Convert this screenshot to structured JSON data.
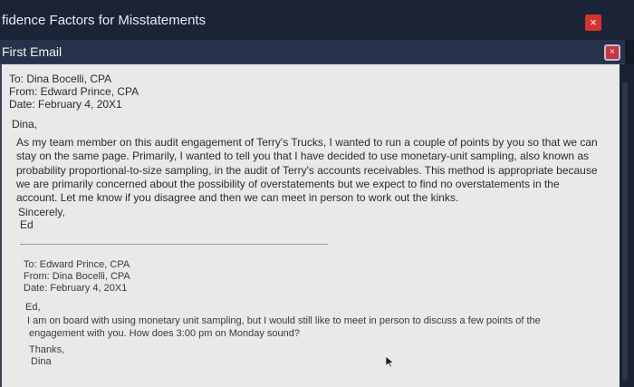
{
  "window": {
    "title": "fidence Factors for Misstatements",
    "close_label": "×"
  },
  "panel": {
    "title": "First Email",
    "close_label": "×"
  },
  "email1": {
    "to": "To: Dina Bocelli, CPA",
    "from": "From: Edward Prince, CPA",
    "date": "Date: February 4, 20X1",
    "greeting": "Dina,",
    "body": "As my team member on this audit engagement of Terry's Trucks, I wanted to run a couple of points by you so that we can stay on the same page. Primarily, I wanted to tell you that I have decided to use monetary-unit sampling, also known as probability proportional-to-size sampling, in the audit of Terry's accounts receivables. This method is appropriate because we are primarily concerned about the possibility of overstatements but we expect to find no overstatements in the account. Let me know if you disagree and then we can meet in person to work out the kinks.",
    "closing": "Sincerely,",
    "signature": "Ed"
  },
  "email2": {
    "to": "To: Edward Prince, CPA",
    "from": "From: Dina Bocelli, CPA",
    "date": "Date: February 4, 20X1",
    "greeting": "Ed,",
    "body_line1": "I am on board with using monetary unit sampling, but I would still like to meet in person to discuss a few points of the",
    "body_line2": "engagement with you. How does 3:00 pm on Monday sound?",
    "closing": "Thanks,",
    "signature": "Dina"
  },
  "colors": {
    "title_bar": "#1b2436",
    "panel_header": "#26324a",
    "content_bg": "#e9e9ea",
    "close_red": "#d6322f"
  },
  "icons": {
    "window_close": "close-icon",
    "panel_close": "close-icon",
    "pointer": "mouse-cursor-icon"
  }
}
